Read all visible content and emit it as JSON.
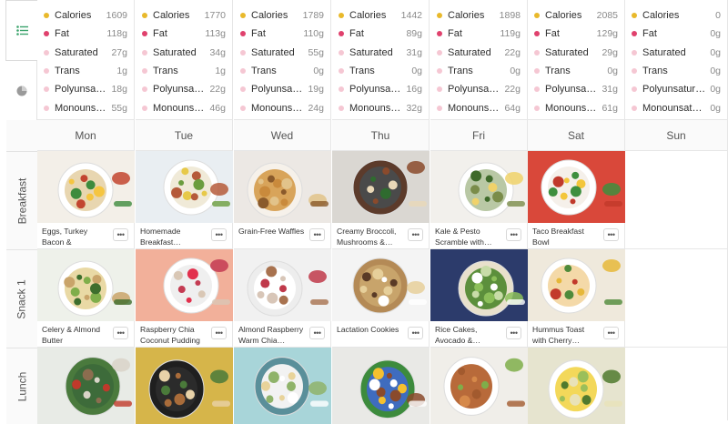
{
  "rail": {
    "icons": [
      "list-icon",
      "pie-chart-icon"
    ]
  },
  "colors": {
    "calories": "#e9b92b",
    "fat": "#e0416d",
    "subfat": "#f5c7d3",
    "accent": "#3aa36b"
  },
  "nutrition_labels": [
    "Calories",
    "Fat",
    "Saturated",
    "Trans",
    "Polyunsaturated",
    "Monounsaturated"
  ],
  "nutrition": [
    {
      "labels": [
        "Calories",
        "Fat",
        "Saturated",
        "Trans",
        "Polyunsatur...",
        "Monounsatu..."
      ],
      "values": [
        "1609",
        "118g",
        "27g",
        "1g",
        "18g",
        "55g"
      ]
    },
    {
      "labels": [
        "Calories",
        "Fat",
        "Saturated",
        "Trans",
        "Polyunsatur...",
        "Monounsatur..."
      ],
      "values": [
        "1770",
        "113g",
        "34g",
        "1g",
        "22g",
        "46g"
      ]
    },
    {
      "labels": [
        "Calories",
        "Fat",
        "Saturated",
        "Trans",
        "Polyunsatur...",
        "Monounsatur..."
      ],
      "values": [
        "1789",
        "110g",
        "55g",
        "0g",
        "19g",
        "24g"
      ]
    },
    {
      "labels": [
        "Calories",
        "Fat",
        "Saturated",
        "Trans",
        "Polyunsatur...",
        "Monounsatur..."
      ],
      "values": [
        "1442",
        "89g",
        "31g",
        "0g",
        "16g",
        "32g"
      ]
    },
    {
      "labels": [
        "Calories",
        "Fat",
        "Saturated",
        "Trans",
        "Polyunsatur...",
        "Monounsatur..."
      ],
      "values": [
        "1898",
        "119g",
        "22g",
        "0g",
        "22g",
        "64g"
      ]
    },
    {
      "labels": [
        "Calories",
        "Fat",
        "Saturated",
        "Trans",
        "Polyunsatur...",
        "Monounsatur..."
      ],
      "values": [
        "2085",
        "129g",
        "29g",
        "0g",
        "31g",
        "61g"
      ]
    },
    {
      "labels": [
        "Calories",
        "Fat",
        "Saturated",
        "Trans",
        "Polyunsaturat...",
        "Monounsatura..."
      ],
      "values": [
        "0",
        "0g",
        "0g",
        "0g",
        "0g",
        "0g"
      ]
    }
  ],
  "days": [
    "Mon",
    "Tue",
    "Wed",
    "Thu",
    "Fri",
    "Sat",
    "Sun"
  ],
  "meals": [
    "Breakfast",
    "Snack 1",
    "Lunch"
  ],
  "more_label": "•••",
  "recipes": {
    "breakfast": [
      "Eggs, Turkey Bacon & Sauteed…",
      "Homemade Breakfast…",
      "Grain-Free Waffles",
      "Creamy Broccoli, Mushrooms &…",
      "Kale & Pesto Scramble with…",
      "Taco Breakfast Bowl"
    ],
    "snack1": [
      "Celery & Almond Butter",
      "Raspberry Chia Coconut Pudding",
      "Almond Raspberry Warm Chia…",
      "Lactation Cookies",
      "Rice Cakes, Avocado &…",
      "Hummus Toast with Cherry…"
    ]
  }
}
